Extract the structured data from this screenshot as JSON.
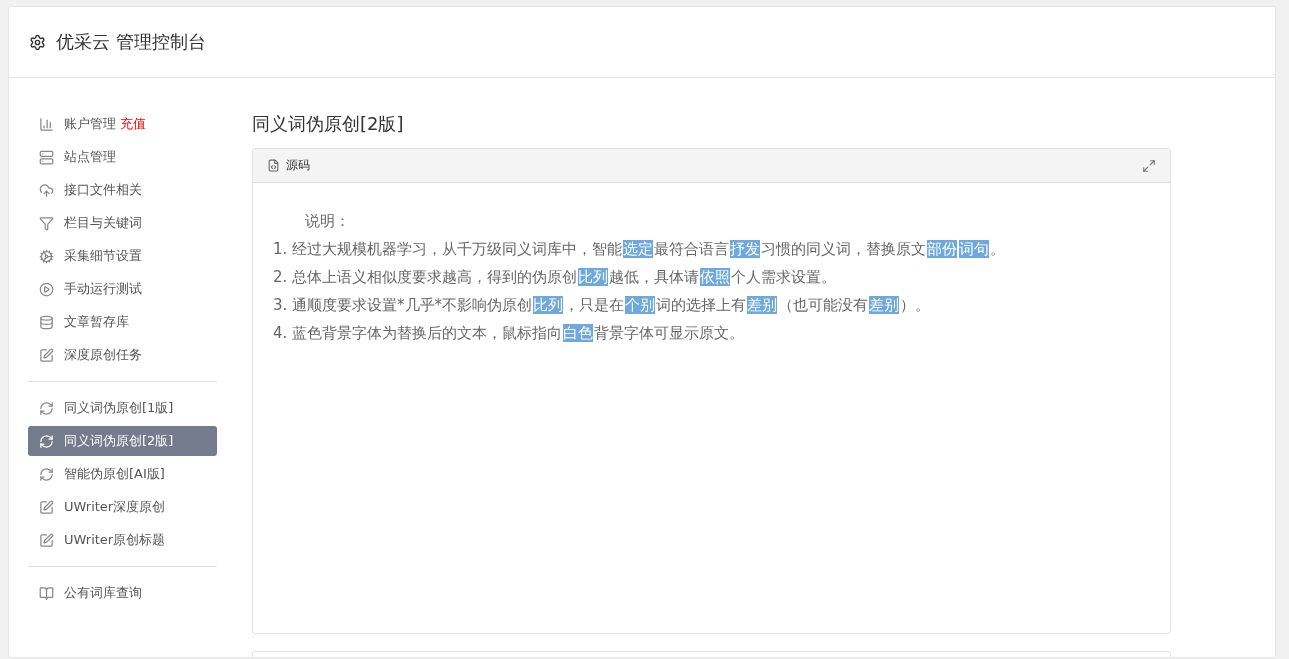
{
  "header": {
    "title": "优采云 管理控制台"
  },
  "sidebar": {
    "groups": [
      {
        "items": [
          {
            "kind": "chart",
            "label": "账户管理",
            "badge": "充值",
            "selected": false
          },
          {
            "kind": "server",
            "label": "站点管理",
            "selected": false
          },
          {
            "kind": "cloud",
            "label": "接口文件相关",
            "selected": false
          },
          {
            "kind": "filter",
            "label": "栏目与关键词",
            "selected": false
          },
          {
            "kind": "cogs",
            "label": "采集细节设置",
            "selected": false
          },
          {
            "kind": "play",
            "label": "手动运行测试",
            "selected": false
          },
          {
            "kind": "database",
            "label": "文章暂存库",
            "selected": false
          },
          {
            "kind": "edit",
            "label": "深度原创任务",
            "selected": false
          }
        ]
      },
      {
        "items": [
          {
            "kind": "refresh",
            "label": "同义词伪原创[1版]",
            "selected": false
          },
          {
            "kind": "refresh",
            "label": "同义词伪原创[2版]",
            "selected": true
          },
          {
            "kind": "refresh",
            "label": "智能伪原创[AI版]",
            "selected": false
          },
          {
            "kind": "edit",
            "label": "UWriter深度原创",
            "selected": false
          },
          {
            "kind": "edit",
            "label": "UWriter原创标题",
            "selected": false
          }
        ]
      },
      {
        "items": [
          {
            "kind": "book",
            "label": "公有词库查询",
            "selected": false
          }
        ]
      }
    ]
  },
  "main": {
    "title": "同义词伪原创[2版]",
    "editor": {
      "toolbar": {
        "source_button": "源码"
      },
      "heading": "说明：",
      "lines": [
        [
          {
            "text": "1. 经过大规模机器学习，从千万级同义词库中，智能",
            "replaced": false
          },
          {
            "text": "选定",
            "replaced": true
          },
          {
            "text": "最符合语言",
            "replaced": false
          },
          {
            "text": "抒发",
            "replaced": true
          },
          {
            "text": "习惯的同义词，替换原文",
            "replaced": false
          },
          {
            "text": "部份",
            "replaced": true
          },
          {
            "text": "词句",
            "replaced": true
          },
          {
            "text": "。",
            "replaced": false
          }
        ],
        [
          {
            "text": "2. 总体上语义相似度要求越高，得到的伪原创",
            "replaced": false
          },
          {
            "text": "比列",
            "replaced": true
          },
          {
            "text": "越低，具体请",
            "replaced": false
          },
          {
            "text": "依照",
            "replaced": true
          },
          {
            "text": "个人需求设置。",
            "replaced": false
          }
        ],
        [
          {
            "text": "3. 通顺度要求设置*几乎*不影响伪原创",
            "replaced": false
          },
          {
            "text": "比列",
            "replaced": true
          },
          {
            "text": "，只是在",
            "replaced": false
          },
          {
            "text": "个别",
            "replaced": true
          },
          {
            "text": "词的选择上有",
            "replaced": false
          },
          {
            "text": "差别",
            "replaced": true
          },
          {
            "text": "（也可能没有",
            "replaced": false
          },
          {
            "text": "差别",
            "replaced": true
          },
          {
            "text": "）。",
            "replaced": false
          }
        ],
        [
          {
            "text": "4. 蓝色背景字体为替换后的文本，鼠标指向",
            "replaced": false
          },
          {
            "text": "白色",
            "replaced": true
          },
          {
            "text": "背景字体可显示原文。",
            "replaced": false
          }
        ]
      ]
    }
  }
}
